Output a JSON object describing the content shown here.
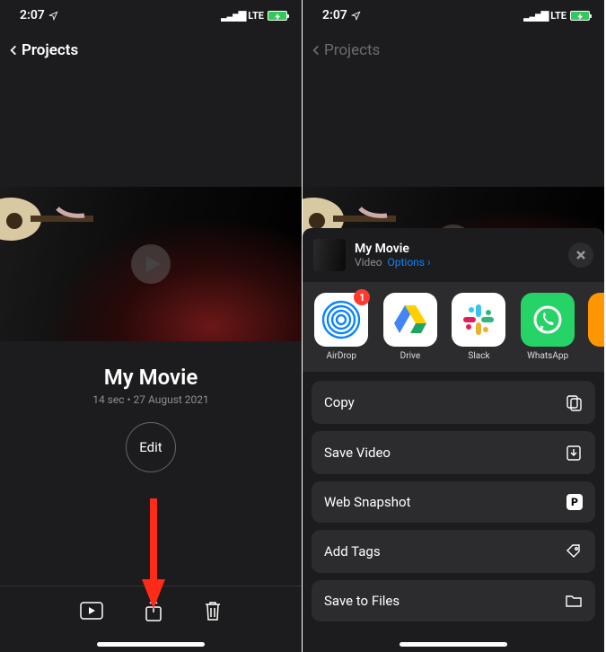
{
  "status": {
    "time": "2:07",
    "carrier": "LTE"
  },
  "nav": {
    "back_label": "Projects"
  },
  "movie": {
    "title": "My Movie",
    "meta": "14 sec • 27 August 2021",
    "edit_label": "Edit"
  },
  "share": {
    "title": "My Movie",
    "kind": "Video",
    "options_label": "Options",
    "apps": [
      {
        "name": "AirDrop",
        "badge": "1"
      },
      {
        "name": "Drive",
        "badge": null
      },
      {
        "name": "Slack",
        "badge": null
      },
      {
        "name": "WhatsApp",
        "badge": null
      }
    ],
    "actions": {
      "copy": "Copy",
      "save_video": "Save Video",
      "web_snapshot": "Web Snapshot",
      "add_tags": "Add Tags",
      "save_to_files": "Save to Files"
    }
  }
}
